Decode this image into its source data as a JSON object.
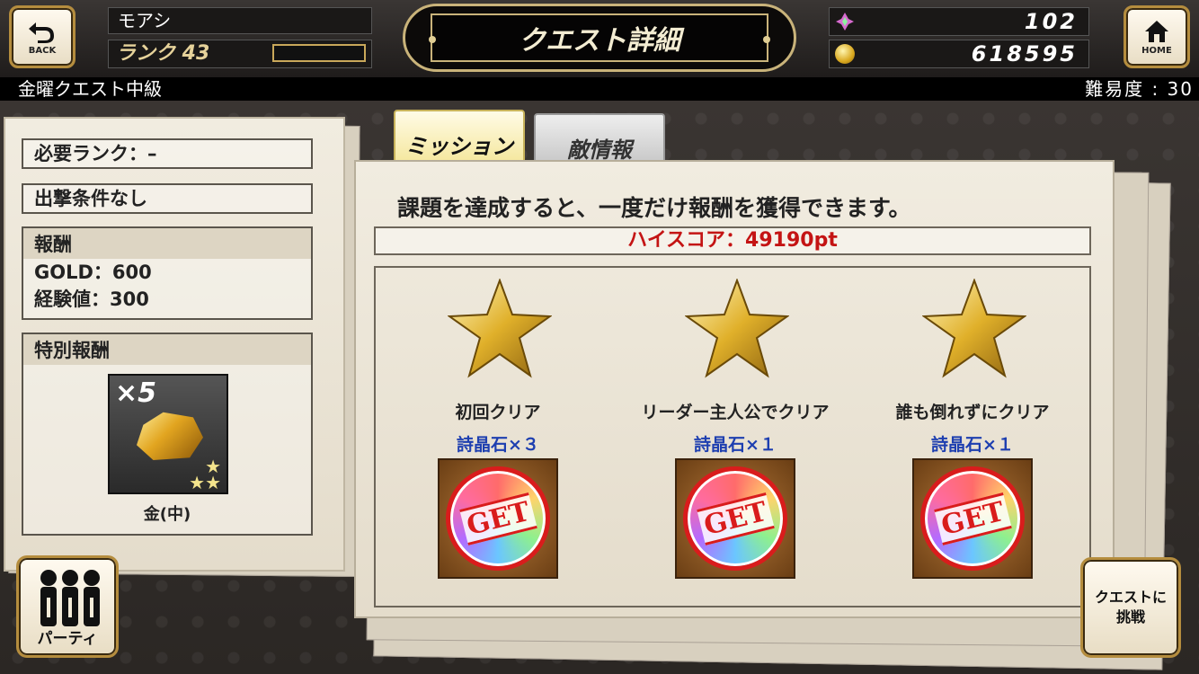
{
  "header": {
    "back_label": "BACK",
    "home_label": "HOME",
    "player_name": "モアシ",
    "rank_text": "ランク 43",
    "title": "クエスト詳細",
    "crystal_count": "102",
    "gold_count": "618595"
  },
  "quest": {
    "name": "金曜クエスト中級",
    "difficulty": "難易度 : 30"
  },
  "left": {
    "required_rank": "必要ランク：–",
    "sortie_condition": "出撃条件なし",
    "reward_header": "報酬",
    "reward_gold": "GOLD：600",
    "reward_exp": "経験値：300",
    "special_header": "特別報酬",
    "special_item_count": "×5",
    "special_item_name": "金(中)"
  },
  "tabs": {
    "mission": "ミッション",
    "enemy": "敵情報"
  },
  "main": {
    "description": "課題を達成すると、一度だけ報酬を獲得できます。",
    "high_score": "ハイスコア：49190pt",
    "get_label": "GET",
    "missions": [
      {
        "label": "初回クリア",
        "reward": "詩晶石×３"
      },
      {
        "label": "リーダー主人公でクリア",
        "reward": "詩晶石×１"
      },
      {
        "label": "誰も倒れずにクリア",
        "reward": "詩晶石×１"
      }
    ]
  },
  "buttons": {
    "party": "パーティ",
    "challenge_line1": "クエストに",
    "challenge_line2": "挑戦"
  },
  "colors": {
    "highscore": "#c41414",
    "reward": "#1e3fb0",
    "gold_trim": "#b58d3e"
  }
}
